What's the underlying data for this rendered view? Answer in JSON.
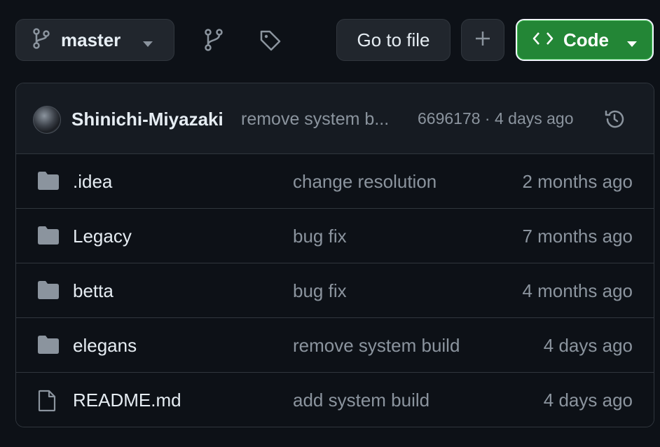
{
  "toolbar": {
    "branch_label": "master",
    "goto_label": "Go to file",
    "code_label": "Code"
  },
  "commit": {
    "author": "Shinichi-Miyazaki",
    "message": "remove system b...",
    "meta": "6696178 · 4 days ago"
  },
  "files": [
    {
      "type": "folder",
      "name": ".idea",
      "message": "change resolution",
      "date": "2 months ago"
    },
    {
      "type": "folder",
      "name": "Legacy",
      "message": "bug fix",
      "date": "7 months ago"
    },
    {
      "type": "folder",
      "name": "betta",
      "message": "bug fix",
      "date": "4 months ago"
    },
    {
      "type": "folder",
      "name": "elegans",
      "message": "remove system build",
      "date": "4 days ago"
    },
    {
      "type": "file",
      "name": "README.md",
      "message": "add system build",
      "date": "4 days ago"
    }
  ],
  "colors": {
    "background": "#0d1117",
    "border": "#30363d",
    "accent_green": "#238636",
    "muted_text": "#8b949e"
  },
  "icons": {
    "branch": "git-branch-icon",
    "tags": "tag-icon",
    "plus": "plus-icon",
    "code": "code-brackets-icon",
    "history": "history-icon",
    "folder": "folder-icon",
    "file": "file-icon"
  }
}
